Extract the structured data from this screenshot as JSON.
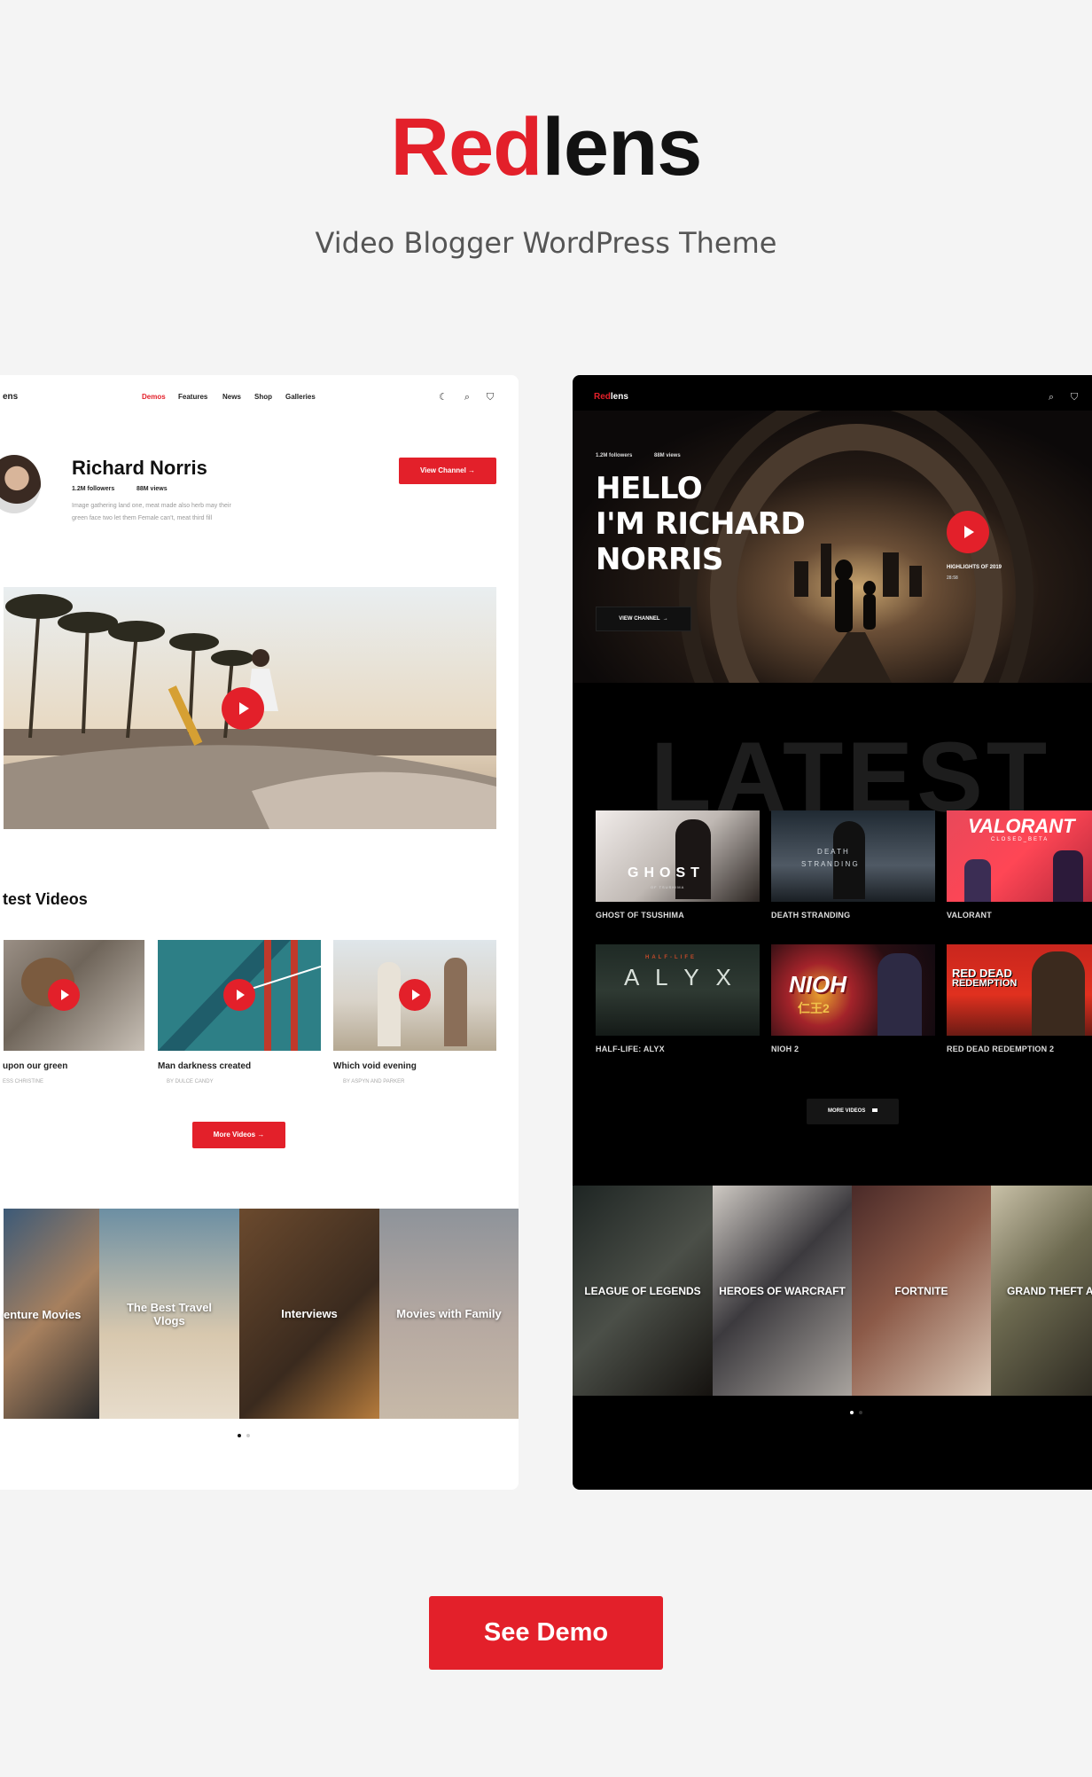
{
  "header": {
    "brand_red": "Red",
    "brand_dark": "lens",
    "tagline": "Video Blogger WordPress Theme"
  },
  "light": {
    "logo": "ens",
    "nav": [
      "Demos",
      "Features",
      "News",
      "Shop",
      "Galleries"
    ],
    "profile": {
      "name": "Richard Norris",
      "followers": "1.2M followers",
      "views": "88M views",
      "bio_line1": "Image gathering land one, meat made also herb may their",
      "bio_line2": "green face two let them Female can't, meat third fill"
    },
    "view_channel": "View Channel",
    "latest_heading": "test Videos",
    "videos": [
      {
        "title": "upon our green",
        "author": "ESS CHRISTINE"
      },
      {
        "title": "Man darkness created",
        "author": "BY DULCE CANDY"
      },
      {
        "title": "Which void evening",
        "author": "BY ASPYN AND PARKER"
      }
    ],
    "more_videos": "More Videos",
    "categories": [
      "enture Movies",
      "The Best Travel Vlogs",
      "Interviews",
      "Movies with Family"
    ]
  },
  "dark": {
    "logo_red": "Red",
    "logo_white": "lens",
    "followers": "1.2M followers",
    "views": "88M views",
    "hero_line1": "HELLO",
    "hero_line2": "I'M RICHARD",
    "hero_line3": "NORRIS",
    "view_channel": "VIEW CHANNEL",
    "highlight_title": "HIGHLIGHTS OF 2019",
    "highlight_time": "28:58",
    "watermark": "LATEST",
    "games": [
      "GHOST OF TSUSHIMA",
      "DEATH STRANDING",
      "VALORANT",
      "HALF-LIFE: ALYX",
      "NIOH 2",
      "RED DEAD REDEMPTION 2"
    ],
    "game_art": {
      "ghost": "GHOST",
      "ghost_sub": "OF TSUSHIMA",
      "death": "D E A T H",
      "stranding": "S T R A N D I N G",
      "valorant": "VALORANT",
      "valorant_sub": "CLOSED_BETA",
      "halflife": "HALF-LIFE",
      "alyx": "A L Y X",
      "nioh": "NIOH",
      "nioh_num": "仁王2",
      "rdr1": "RED DEAD",
      "rdr2": "REDEMPTION"
    },
    "more_videos": "MORE VIDEOS",
    "heroes": [
      "LEAGUE OF LEGENDS",
      "HEROES OF WARCRAFT",
      "FORTNITE",
      "GRAND THEFT AU"
    ]
  },
  "cta": {
    "see_demo": "See Demo"
  },
  "colors": {
    "accent": "#e3202a",
    "dark_bg": "#000000",
    "page_bg": "#f4f4f4"
  }
}
